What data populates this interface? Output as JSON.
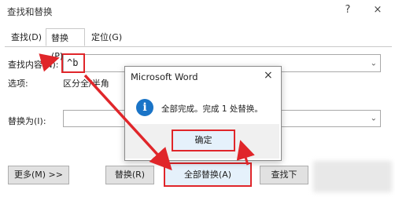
{
  "window": {
    "title": "查找和替换",
    "help": "?",
    "close": "×"
  },
  "tabs": [
    {
      "label": "查找(D)"
    },
    {
      "label": "替换(P)"
    },
    {
      "label": "定位(G)"
    }
  ],
  "find": {
    "label": "查找内容(N):",
    "value": "^b"
  },
  "options": {
    "label": "选项:",
    "value": "区分全/半角"
  },
  "replace": {
    "label": "替换为(I):",
    "value": ""
  },
  "buttons": {
    "more": "更多(M) >>",
    "replace": "替换(R)",
    "replace_all": "全部替换(A)",
    "find_next": "查找下"
  },
  "dialog": {
    "title": "Microsoft Word",
    "close": "×",
    "message": "全部完成。完成 1 处替换。",
    "ok": "确定"
  },
  "icons": {
    "info": "i",
    "combo_arrow": "⌄"
  },
  "colors": {
    "highlight": "#e0262a",
    "info": "#1a74c7"
  }
}
